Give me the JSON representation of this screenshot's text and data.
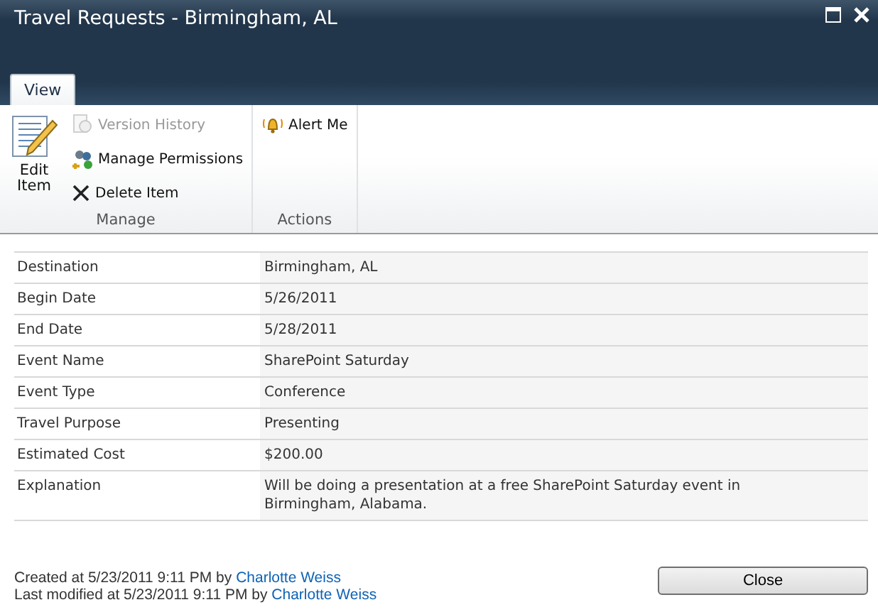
{
  "window": {
    "title": "Travel Requests - Birmingham, AL"
  },
  "tabs": [
    {
      "label": "View",
      "selected": true
    }
  ],
  "ribbon": {
    "groups": [
      {
        "label": "Manage",
        "items": [
          {
            "kind": "large",
            "label": "Edit Item",
            "disabled": false
          },
          {
            "kind": "small",
            "label": "Version History",
            "disabled": true
          },
          {
            "kind": "small",
            "label": "Manage Permissions",
            "disabled": false
          },
          {
            "kind": "small",
            "label": "Delete Item",
            "disabled": false
          }
        ]
      },
      {
        "label": "Actions",
        "items": [
          {
            "kind": "small",
            "label": "Alert Me",
            "disabled": false
          }
        ]
      }
    ]
  },
  "fields": [
    {
      "label": "Destination",
      "value": "Birmingham, AL"
    },
    {
      "label": "Begin Date",
      "value": "5/26/2011"
    },
    {
      "label": "End Date",
      "value": "5/28/2011"
    },
    {
      "label": "Event Name",
      "value": "SharePoint Saturday"
    },
    {
      "label": "Event Type",
      "value": "Conference"
    },
    {
      "label": "Travel Purpose",
      "value": "Presenting"
    },
    {
      "label": "Estimated Cost",
      "value": "$200.00"
    },
    {
      "label": "Explanation",
      "value": "Will be doing a presentation at a free SharePoint Saturday event in Birmingham, Alabama."
    }
  ],
  "footer": {
    "created": {
      "text": "Created at 5/23/2011 9:11 PM by",
      "author": "Charlotte Weiss"
    },
    "modified": {
      "text": "Last modified at 5/23/2011 9:11 PM by",
      "author": "Charlotte Weiss"
    }
  },
  "buttons": [
    "Close"
  ]
}
